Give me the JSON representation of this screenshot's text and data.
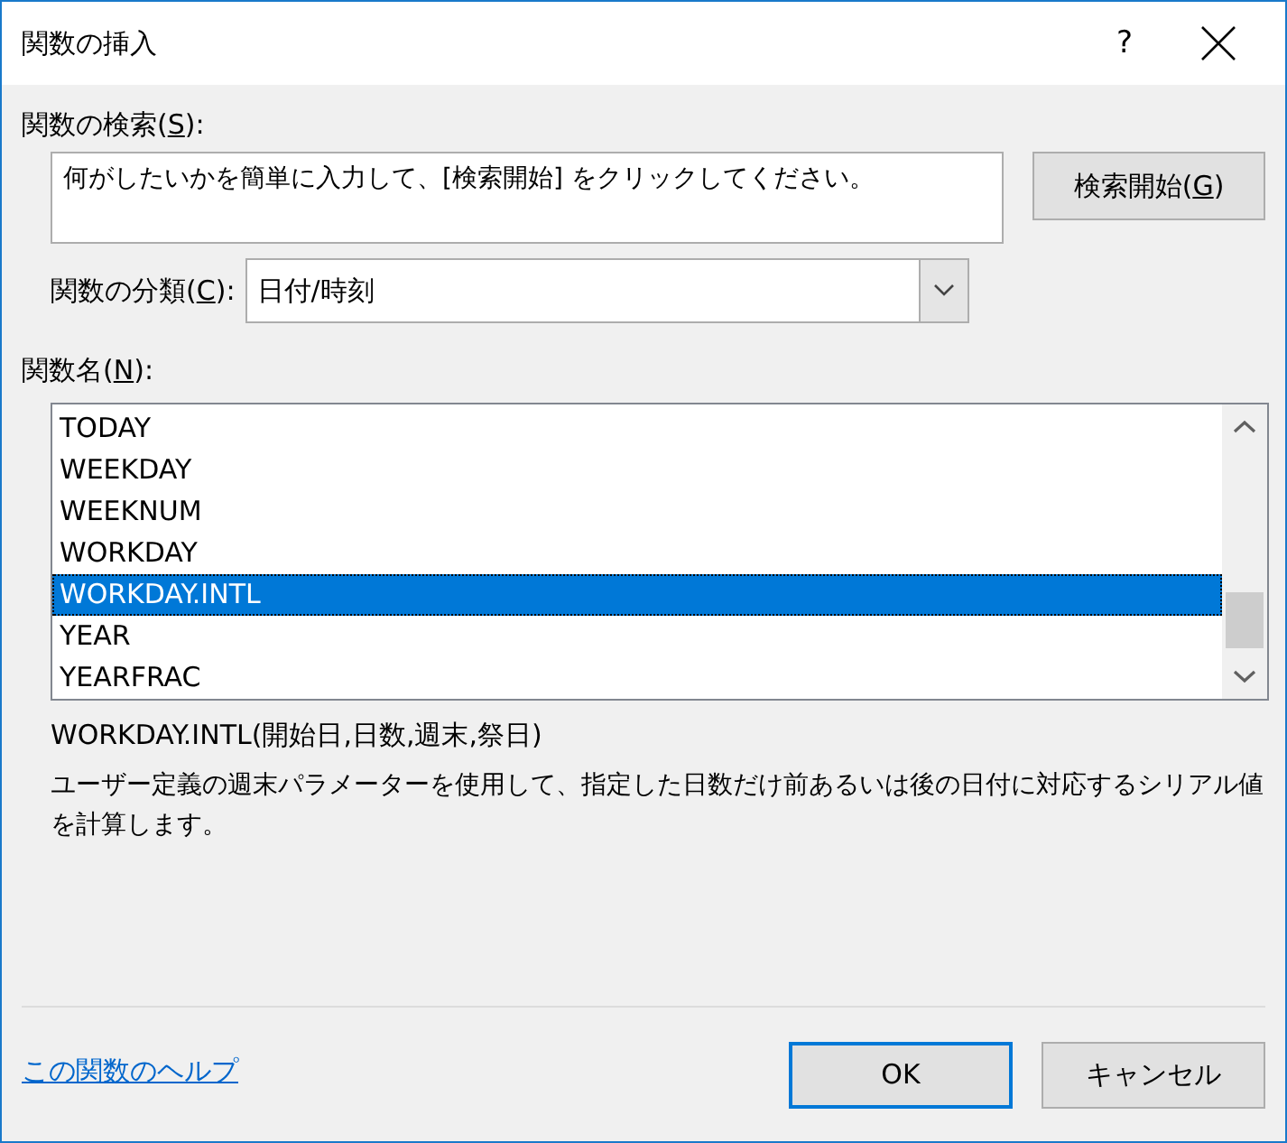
{
  "window": {
    "title": "関数の挿入",
    "help_glyph": "?"
  },
  "search": {
    "label": {
      "before": "関数の検索(",
      "key": "S",
      "after": "):"
    },
    "value": "何がしたいかを簡単に入力して、[検索開始] をクリックしてください。",
    "button": {
      "before": "検索開始(",
      "key": "G",
      "after": ")"
    }
  },
  "category": {
    "label": {
      "before": "関数の分類(",
      "key": "C",
      "after": "):"
    },
    "value": "日付/時刻"
  },
  "functions": {
    "label": {
      "before": "関数名(",
      "key": "N",
      "after": "):"
    },
    "items": [
      {
        "name": "TODAY",
        "selected": false
      },
      {
        "name": "WEEKDAY",
        "selected": false
      },
      {
        "name": "WEEKNUM",
        "selected": false
      },
      {
        "name": "WORKDAY",
        "selected": false
      },
      {
        "name": "WORKDAY.INTL",
        "selected": true
      },
      {
        "name": "YEAR",
        "selected": false
      },
      {
        "name": "YEARFRAC",
        "selected": false
      }
    ]
  },
  "syntax": "WORKDAY.INTL(開始日,日数,週末,祭日)",
  "description": "ユーザー定義の週末パラメーターを使用して、指定した日数だけ前あるいは後の日付に対応するシリアル値を計算します。",
  "help_link": "この関数のヘルプ",
  "buttons": [
    {
      "label": "OK",
      "default": true
    },
    {
      "label": "キャンセル",
      "default": false
    }
  ]
}
